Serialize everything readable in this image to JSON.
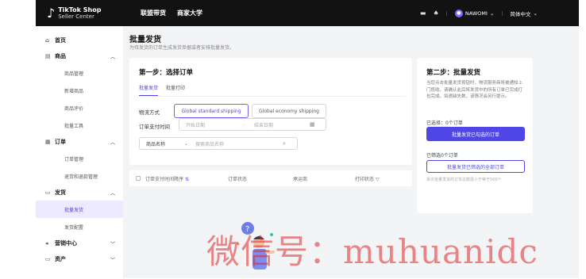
{
  "app": {
    "logo_line1": "TikTok Shop",
    "logo_line2": "Seller Center",
    "nav": [
      "联盟带货",
      "商家大学"
    ],
    "user_name": "NAWOMI",
    "language": "简体中文"
  },
  "sidebar": {
    "home": "首页",
    "products": {
      "label": "商品",
      "items": [
        "商品管理",
        "新增商品",
        "商品评价",
        "批量工具"
      ]
    },
    "orders": {
      "label": "订单",
      "items": [
        "订单管理",
        "退货和退款管理"
      ]
    },
    "shipping": {
      "label": "发货",
      "items": [
        "批量发货",
        "发货配置"
      ]
    },
    "marketing": "营销中心",
    "assets": "资产"
  },
  "page": {
    "title": "批量发货",
    "subtitle": "为待发货的订单生成发货单据或者安排批量发货。"
  },
  "step1": {
    "title": "第一步：选择订单",
    "tabs": [
      "批量发货",
      "批量打印"
    ],
    "shipping_label": "物流方式",
    "shipping_options": [
      "Global standard shipping",
      "Global economy shipping"
    ],
    "time_label": "订单支付时间",
    "start_placeholder": "开始日期",
    "separator": "-",
    "end_placeholder": "结束日期",
    "product_select": "商品名称",
    "search_placeholder": "搜索商品名称"
  },
  "table": {
    "headers": [
      "订单支付时间降序",
      "订单状态",
      "承运商",
      "打印状态"
    ]
  },
  "step2": {
    "title": "第二步：批量发货",
    "description": "当您点击批量发货按钮时，物流服务商将被通知上门揽收。请确认此后将发货中的所有订单已完成打包完成。如遇缺失数，该情况会另行提示。",
    "selected_count": "已选择：0个订单",
    "btn_selected": "批量发货已勾选的订单",
    "filtered_count": "已筛选0个订单",
    "btn_filtered": "批量发货已筛选的全部订单",
    "note": "单次批量发货的订单总数需小于等于500个"
  },
  "watermark": "微信号：muhuanidc",
  "colors": {
    "accent": "#4f46e5",
    "topbar": "#121212",
    "watermark": "#dc2828"
  }
}
